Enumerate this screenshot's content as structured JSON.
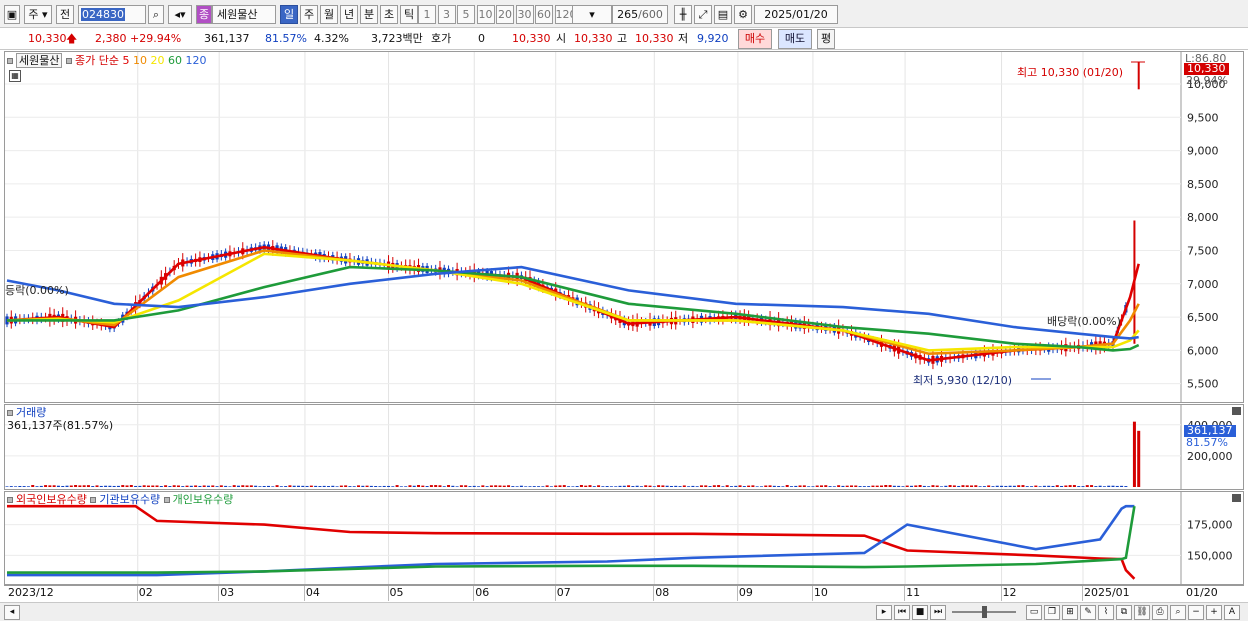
{
  "toolbar": {
    "market_mode": "주",
    "prev_label": "전",
    "code": "024830",
    "search_icon": "search-icon",
    "tag": "종",
    "stock_name": "세원물산",
    "period_tabs": [
      "일",
      "주",
      "월",
      "년",
      "분",
      "초",
      "틱"
    ],
    "active_period": "일",
    "minute_options": [
      "1",
      "3",
      "5",
      "10",
      "20",
      "30",
      "60",
      "120"
    ],
    "count_current": "265",
    "count_total": "/600",
    "date": "2025/01/20"
  },
  "quote": {
    "price": "10,330",
    "change": "2,380",
    "change_pct": "+29.94%",
    "volume": "361,137",
    "vol_ratio": "81.57%",
    "turnover": "4.32%",
    "amount": "3,723백만",
    "hoga_label": "호가",
    "hoga_value": "0",
    "bid": "10,330",
    "open_label": "시",
    "open": "10,330",
    "high_label": "고",
    "high": "10,330",
    "low_label": "저",
    "low": "9,920",
    "buy_label": "매수",
    "sell_label": "매도",
    "eval_label": "평"
  },
  "price_panel": {
    "name": "세원물산",
    "ma_label": "종가 단순",
    "ma_periods": [
      "5",
      "10",
      "20",
      "60",
      "120"
    ],
    "ma_colors": [
      "#e00000",
      "#f08a00",
      "#f5e600",
      "#1e9b3a",
      "#2a5fd8"
    ],
    "right_tag_top": "L:86.80",
    "right_tag_price": "10,330",
    "right_tag_pct": "29.94%",
    "high_annot": "최고 10,330 (01/20)",
    "low_annot": "최저 5,930 (12/10)",
    "event_left": "등락(0.00%)",
    "event_right": "배당락(0.00%)"
  },
  "volume_panel": {
    "title": "거래량",
    "value_text": "361,137주(81.57%)",
    "right_tag": "361,137",
    "right_pct": "81.57%"
  },
  "holding_panel": {
    "s1": "외국인보유수량",
    "s2": "기관보유수량",
    "s3": "개인보유수량",
    "s1_color": "#e00000",
    "s2_color": "#2a5fd8",
    "s3_color": "#1e9b3a"
  },
  "x_axis": [
    "2023/12",
    "02",
    "03",
    "04",
    "05",
    "06",
    "07",
    "08",
    "09",
    "10",
    "11",
    "12",
    "2025/01",
    "01/20"
  ],
  "chart_data": [
    {
      "type": "line",
      "title": "세원물산",
      "ylim": [
        5300,
        10300
      ],
      "y_ticks": [
        "10,000",
        "9,500",
        "9,000",
        "8,500",
        "8,000",
        "7,500",
        "7,000",
        "6,500",
        "6,000",
        "5,500"
      ],
      "y_tick_values": [
        10000,
        9500,
        9000,
        8500,
        8000,
        7500,
        7000,
        6500,
        6000,
        5500
      ],
      "x": [
        0,
        12,
        25,
        40,
        60,
        80,
        100,
        120,
        145,
        170,
        195,
        215,
        235,
        250,
        258,
        262,
        264
      ],
      "series": [
        {
          "name": "5",
          "values": [
            6450,
            6500,
            6350,
            7300,
            7550,
            7350,
            7200,
            7100,
            6400,
            6500,
            6300,
            5850,
            6000,
            6050,
            6100,
            6800,
            7300
          ]
        },
        {
          "name": "10",
          "values": [
            6450,
            6480,
            6380,
            7100,
            7500,
            7350,
            7200,
            7050,
            6450,
            6450,
            6300,
            5950,
            6000,
            6050,
            6100,
            6450,
            6700
          ]
        },
        {
          "name": "20",
          "values": [
            6450,
            6470,
            6420,
            6750,
            7450,
            7350,
            7200,
            7000,
            6450,
            6450,
            6300,
            6000,
            6050,
            6050,
            6050,
            6150,
            6300
          ]
        },
        {
          "name": "60",
          "values": [
            6450,
            6450,
            6450,
            6600,
            6950,
            7250,
            7200,
            7100,
            6700,
            6550,
            6350,
            6250,
            6100,
            6050,
            6000,
            6020,
            6080
          ]
        },
        {
          "name": "120",
          "values": [
            7050,
            6900,
            6700,
            6650,
            6800,
            7000,
            7150,
            7250,
            6900,
            6700,
            6650,
            6550,
            6350,
            6250,
            6200,
            6180,
            6200
          ]
        }
      ]
    },
    {
      "type": "bar",
      "title": "거래량",
      "y_ticks": [
        "400,000",
        "200,000"
      ],
      "y_tick_values": [
        400000,
        200000
      ],
      "ylim": [
        0,
        450000
      ],
      "bars": [
        {
          "x": 263,
          "value": 420000
        },
        {
          "x": 264,
          "value": 361137
        }
      ]
    },
    {
      "type": "line",
      "title": "보유수량",
      "y_ticks": [
        "175,000",
        "150,000"
      ],
      "y_tick_values": [
        175000,
        150000
      ],
      "ylim": [
        130000,
        195000
      ],
      "x": [
        0,
        30,
        35,
        60,
        80,
        100,
        140,
        160,
        200,
        210,
        240,
        255,
        260,
        261,
        263
      ],
      "series": [
        {
          "name": "외국인보유수량",
          "values": [
            190000,
            190000,
            178000,
            175000,
            169000,
            168000,
            167500,
            167500,
            166000,
            154000,
            150000,
            147500,
            147000,
            138000,
            131000
          ]
        },
        {
          "name": "기관보유수량",
          "values": [
            134000,
            134000,
            134000,
            137000,
            140000,
            143000,
            145000,
            148000,
            152000,
            175000,
            155000,
            163000,
            188000,
            190000,
            190000
          ]
        },
        {
          "name": "개인보유수량",
          "values": [
            136000,
            136000,
            136000,
            137000,
            139000,
            141000,
            141500,
            141500,
            140500,
            141000,
            143000,
            146000,
            147000,
            148000,
            190000
          ]
        }
      ]
    }
  ]
}
